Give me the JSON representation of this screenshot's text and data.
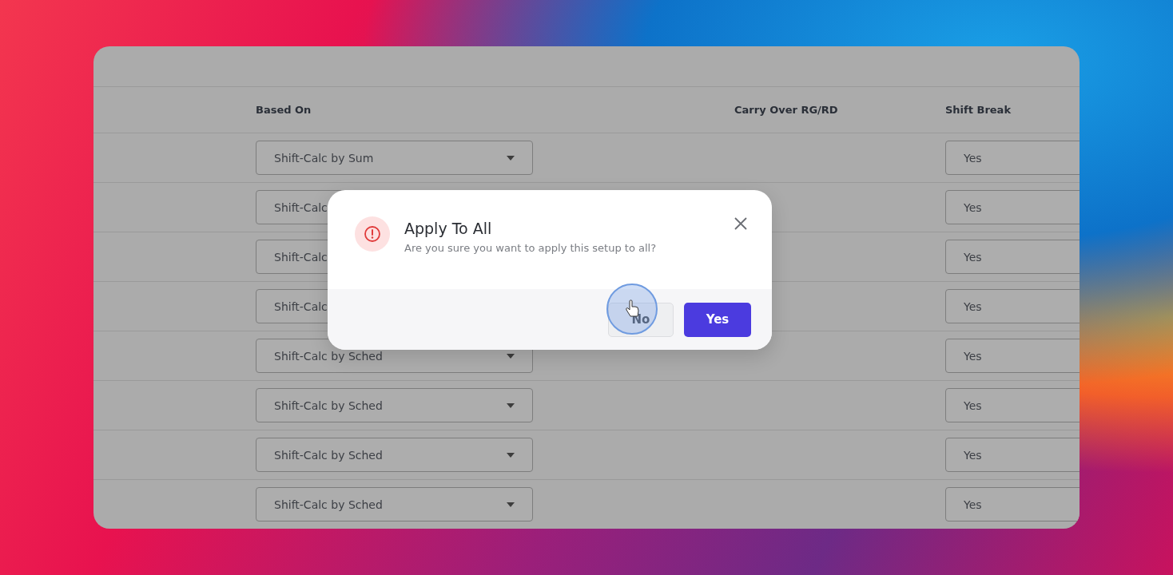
{
  "table": {
    "columns": [
      "Based On",
      "Carry Over RG/RD",
      "Shift Break"
    ],
    "rows": [
      {
        "based_on": "Shift-Calc by Sum",
        "shift_break": "Yes"
      },
      {
        "based_on": "Shift-Calc",
        "shift_break": "Yes"
      },
      {
        "based_on": "Shift-Calc",
        "shift_break": "Yes"
      },
      {
        "based_on": "Shift-Calc",
        "shift_break": "Yes"
      },
      {
        "based_on": "Shift-Calc by Sched",
        "shift_break": "Yes"
      },
      {
        "based_on": "Shift-Calc by Sched",
        "shift_break": "Yes"
      },
      {
        "based_on": "Shift-Calc by Sched",
        "shift_break": "Yes"
      },
      {
        "based_on": "Shift-Calc by Sched",
        "shift_break": "Yes"
      }
    ]
  },
  "dialog": {
    "title": "Apply To All",
    "message": "Are you sure you want to apply this setup to all?",
    "buttons": [
      {
        "label": "No",
        "kind": "secondary"
      },
      {
        "label": "Yes",
        "kind": "primary"
      }
    ]
  }
}
